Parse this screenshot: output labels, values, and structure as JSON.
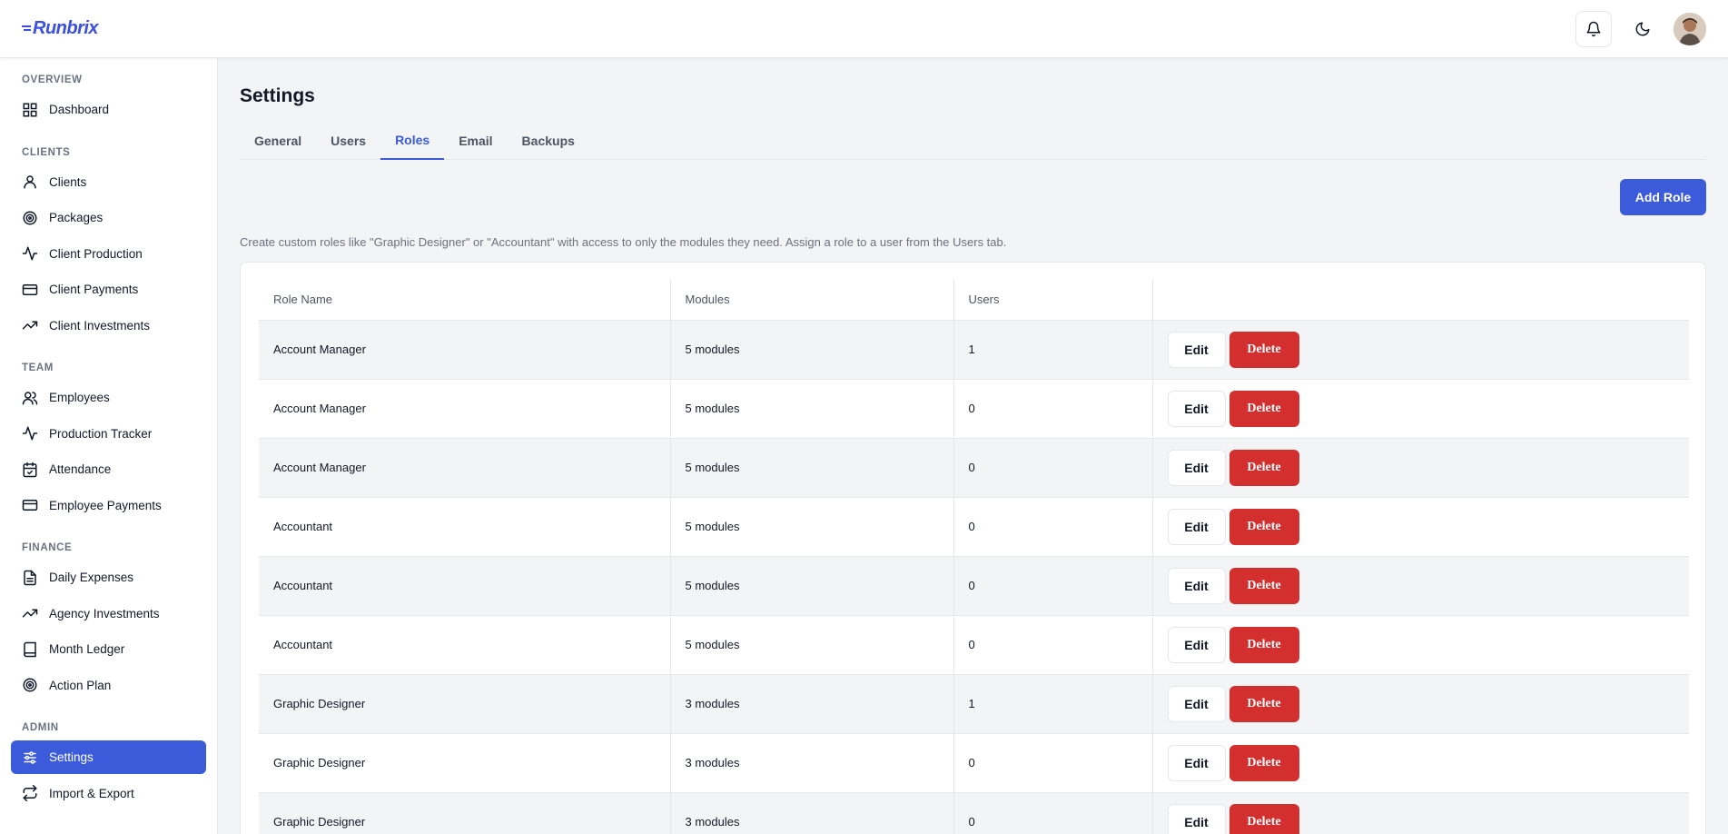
{
  "brand": {
    "name": "Runbrix",
    "color": "#3b4fe0"
  },
  "header": {
    "icons": [
      "bell-icon",
      "moon-icon",
      "avatar"
    ]
  },
  "sidebar": {
    "sections": [
      {
        "label": "OVERVIEW",
        "items": [
          {
            "label": "Dashboard",
            "icon": "grid-icon"
          }
        ]
      },
      {
        "label": "CLIENTS",
        "items": [
          {
            "label": "Clients",
            "icon": "user-icon"
          },
          {
            "label": "Packages",
            "icon": "target-icon"
          },
          {
            "label": "Client Production",
            "icon": "activity-icon"
          },
          {
            "label": "Client Payments",
            "icon": "card-icon"
          },
          {
            "label": "Client Investments",
            "icon": "trending-up-icon"
          }
        ]
      },
      {
        "label": "TEAM",
        "items": [
          {
            "label": "Employees",
            "icon": "users-icon"
          },
          {
            "label": "Production Tracker",
            "icon": "activity-icon"
          },
          {
            "label": "Attendance",
            "icon": "calendar-check-icon"
          },
          {
            "label": "Employee Payments",
            "icon": "card-icon"
          }
        ]
      },
      {
        "label": "FINANCE",
        "items": [
          {
            "label": "Daily Expenses",
            "icon": "file-text-icon"
          },
          {
            "label": "Agency Investments",
            "icon": "trending-up-icon"
          },
          {
            "label": "Month Ledger",
            "icon": "book-icon"
          },
          {
            "label": "Action Plan",
            "icon": "target-icon"
          }
        ]
      },
      {
        "label": "ADMIN",
        "items": [
          {
            "label": "Settings",
            "icon": "sliders-icon",
            "active": true
          },
          {
            "label": "Import & Export",
            "icon": "repeat-icon"
          }
        ]
      }
    ]
  },
  "main": {
    "title": "Settings",
    "tabs": [
      {
        "label": "General"
      },
      {
        "label": "Users"
      },
      {
        "label": "Roles",
        "active": true
      },
      {
        "label": "Email"
      },
      {
        "label": "Backups"
      }
    ],
    "add_button": "Add Role",
    "helper_text": "Create custom roles like \"Graphic Designer\" or \"Accountant\" with access to only the modules they need. Assign a role to a user from the Users tab.",
    "table": {
      "headers": [
        "Role Name",
        "Modules",
        "Users",
        ""
      ],
      "edit_label": "Edit",
      "delete_label": "Delete",
      "rows": [
        {
          "role": "Account Manager",
          "modules": "5 modules",
          "users": "1"
        },
        {
          "role": "Account Manager",
          "modules": "5 modules",
          "users": "0"
        },
        {
          "role": "Account Manager",
          "modules": "5 modules",
          "users": "0"
        },
        {
          "role": "Accountant",
          "modules": "5 modules",
          "users": "0"
        },
        {
          "role": "Accountant",
          "modules": "5 modules",
          "users": "0"
        },
        {
          "role": "Accountant",
          "modules": "5 modules",
          "users": "0"
        },
        {
          "role": "Graphic Designer",
          "modules": "3 modules",
          "users": "1"
        },
        {
          "role": "Graphic Designer",
          "modules": "3 modules",
          "users": "0"
        },
        {
          "role": "Graphic Designer",
          "modules": "3 modules",
          "users": "0"
        }
      ]
    }
  },
  "colors": {
    "accent": "#3b5bdb",
    "danger": "#d32f2f"
  }
}
